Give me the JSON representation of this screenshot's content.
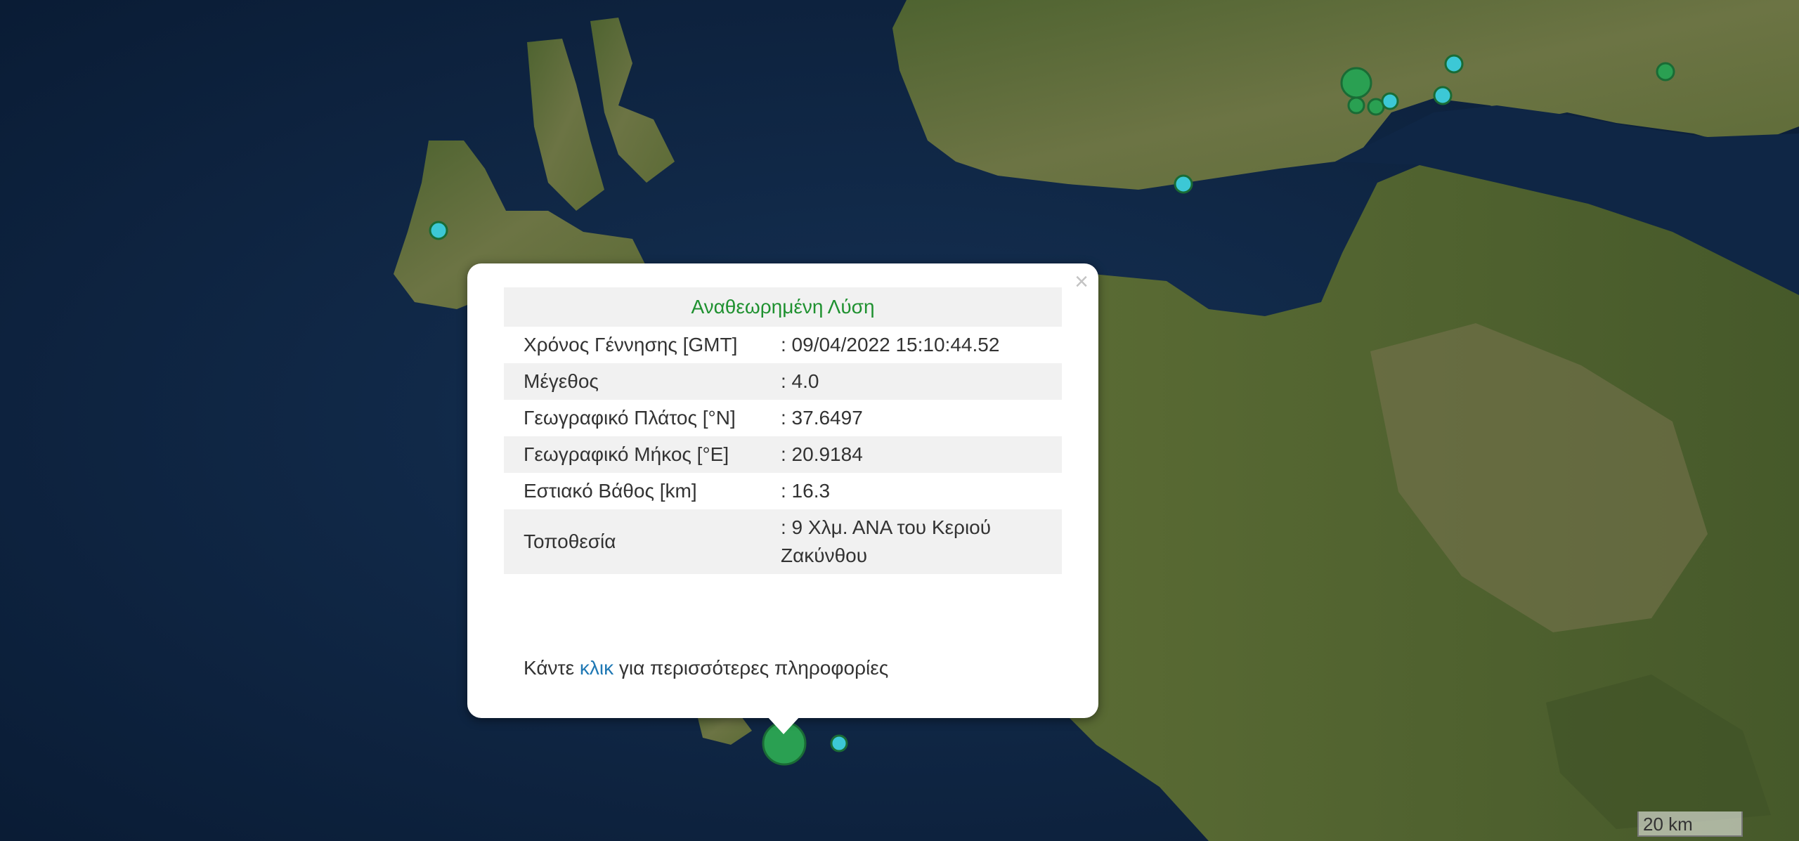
{
  "popup": {
    "title": "Αναθεωρημένη Λύση",
    "rows": [
      {
        "label": "Χρόνος Γέννησης [GMT]",
        "value": ": 09/04/2022 15:10:44.52"
      },
      {
        "label": "Μέγεθος",
        "value": ": 4.0"
      },
      {
        "label": "Γεωγραφικό Πλάτος [°N]",
        "value": ": 37.6497"
      },
      {
        "label": "Γεωγραφικό Μήκος [°E]",
        "value": ": 20.9184"
      },
      {
        "label": "Εστιακό Βάθος [km]",
        "value": ": 16.3"
      },
      {
        "label": "Τοποθεσία",
        "value": ": 9 Χλμ. ΑΝΑ του Κεριού Ζακύνθου"
      }
    ],
    "more_prefix": "Κάντε ",
    "more_link": "κλικ",
    "more_suffix": " για περισσότερες πληροφορίες",
    "close_symbol": "×",
    "close_icon": "close-icon"
  },
  "scale_label": "20 km",
  "colors": {
    "sea": "#0d2340",
    "land": "#5a6b34",
    "event_major": "#2aa052",
    "event_minor": "#3cc8d6",
    "title_green": "#1f9130",
    "link_blue": "#1f78b4"
  },
  "events": [
    {
      "type": "major",
      "label": "selected-event"
    },
    {
      "type": "major"
    },
    {
      "type": "major"
    },
    {
      "type": "major"
    },
    {
      "type": "major"
    },
    {
      "type": "minor"
    },
    {
      "type": "minor"
    },
    {
      "type": "minor"
    },
    {
      "type": "minor"
    },
    {
      "type": "minor"
    },
    {
      "type": "minor"
    }
  ]
}
